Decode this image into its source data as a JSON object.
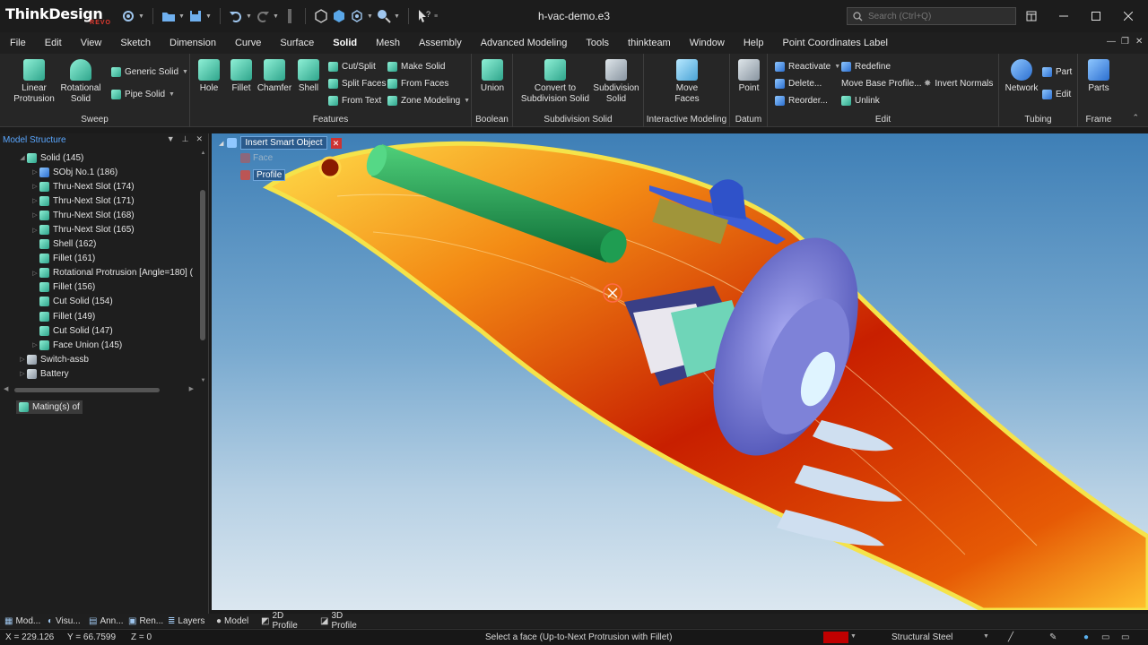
{
  "app": {
    "logo_main": "ThinkDesign",
    "logo_sub": "REVO",
    "title": "h-vac-demo.e3"
  },
  "search": {
    "placeholder": "Search (Ctrl+Q)"
  },
  "menus": [
    "File",
    "Edit",
    "View",
    "Sketch",
    "Dimension",
    "Curve",
    "Surface",
    "Solid",
    "Mesh",
    "Assembly",
    "Advanced Modeling",
    "Tools",
    "thinkteam",
    "Window",
    "Help",
    "Point Coordinates Label"
  ],
  "active_menu": "Solid",
  "ribbon": {
    "sweep": {
      "label": "Sweep",
      "linear": "Linear\nProtrusion",
      "rotational": "Rotational\nSolid",
      "generic": "Generic Solid",
      "pipe": "Pipe Solid"
    },
    "features": {
      "label": "Features",
      "hole": "Hole",
      "fillet": "Fillet",
      "chamfer": "Chamfer",
      "shell": "Shell",
      "cut_split": "Cut/Split",
      "split_faces": "Split Faces",
      "from_text": "From Text",
      "make_solid": "Make Solid",
      "from_faces": "From Faces",
      "zone_modeling": "Zone Modeling"
    },
    "boolean": {
      "label": "Boolean",
      "union": "Union"
    },
    "subdivision": {
      "label": "Subdivision Solid",
      "convert": "Convert to\nSubdivision Solid",
      "subdiv": "Subdivision\nSolid"
    },
    "interactive": {
      "label": "Interactive Modeling",
      "move_faces": "Move\nFaces"
    },
    "datum": {
      "label": "Datum",
      "point": "Point"
    },
    "edit": {
      "label": "Edit",
      "reactivate": "Reactivate",
      "delete": "Delete...",
      "reorder": "Reorder...",
      "redefine": "Redefine",
      "move_base": "Move Base Profile...",
      "unlink": "Unlink",
      "invert_normals": "Invert Normals"
    },
    "tubing": {
      "label": "Tubing",
      "network": "Network",
      "part": "Part",
      "edit": "Edit"
    },
    "frame": {
      "label": "Frame",
      "parts": "Parts"
    }
  },
  "model_structure": {
    "title": "Model Structure",
    "items": [
      {
        "label": "Solid (145)",
        "indent": 1,
        "arrow": "down",
        "icon": "teal"
      },
      {
        "label": "SObj  No.1 (186)",
        "indent": 2,
        "arrow": "right",
        "icon": "blue"
      },
      {
        "label": "Thru-Next Slot (174)",
        "indent": 2,
        "arrow": "right",
        "icon": "teal"
      },
      {
        "label": "Thru-Next Slot (171)",
        "indent": 2,
        "arrow": "right",
        "icon": "teal"
      },
      {
        "label": "Thru-Next Slot (168)",
        "indent": 2,
        "arrow": "right",
        "icon": "teal"
      },
      {
        "label": "Thru-Next Slot (165)",
        "indent": 2,
        "arrow": "right",
        "icon": "teal"
      },
      {
        "label": "Shell (162)",
        "indent": 2,
        "arrow": "",
        "icon": "teal"
      },
      {
        "label": "Fillet (161)",
        "indent": 2,
        "arrow": "",
        "icon": "teal"
      },
      {
        "label": "Rotational Protrusion [Angle=180] (",
        "indent": 2,
        "arrow": "right",
        "icon": "teal"
      },
      {
        "label": "Fillet (156)",
        "indent": 2,
        "arrow": "",
        "icon": "teal"
      },
      {
        "label": "Cut Solid (154)",
        "indent": 2,
        "arrow": "",
        "icon": "teal"
      },
      {
        "label": "Fillet (149)",
        "indent": 2,
        "arrow": "",
        "icon": "teal"
      },
      {
        "label": "Cut Solid (147)",
        "indent": 2,
        "arrow": "",
        "icon": "teal"
      },
      {
        "label": "Face Union (145)",
        "indent": 2,
        "arrow": "right",
        "icon": "teal"
      },
      {
        "label": "Switch-assb",
        "indent": 1,
        "arrow": "right",
        "icon": "gray"
      },
      {
        "label": "Battery",
        "indent": 1,
        "arrow": "right",
        "icon": "gray"
      }
    ],
    "mating": "Mating(s) of"
  },
  "viewport": {
    "smart_object": "Insert Smart Object",
    "option_face": "Face",
    "option_profile": "Profile"
  },
  "bottom_tabs_left": [
    "Mod...",
    "Visu...",
    "Ann...",
    "Ren...",
    "Layers"
  ],
  "bottom_tabs_right": [
    "Model",
    "2D Profile",
    "3D Profile"
  ],
  "status": {
    "x": "X = 229.126",
    "y": "Y = 66.7599",
    "z": "Z = 0",
    "prompt": "Select a face (Up-to-Next Protrusion with Fillet)",
    "material": "Structural Steel",
    "color_swatch": "#c00000"
  }
}
